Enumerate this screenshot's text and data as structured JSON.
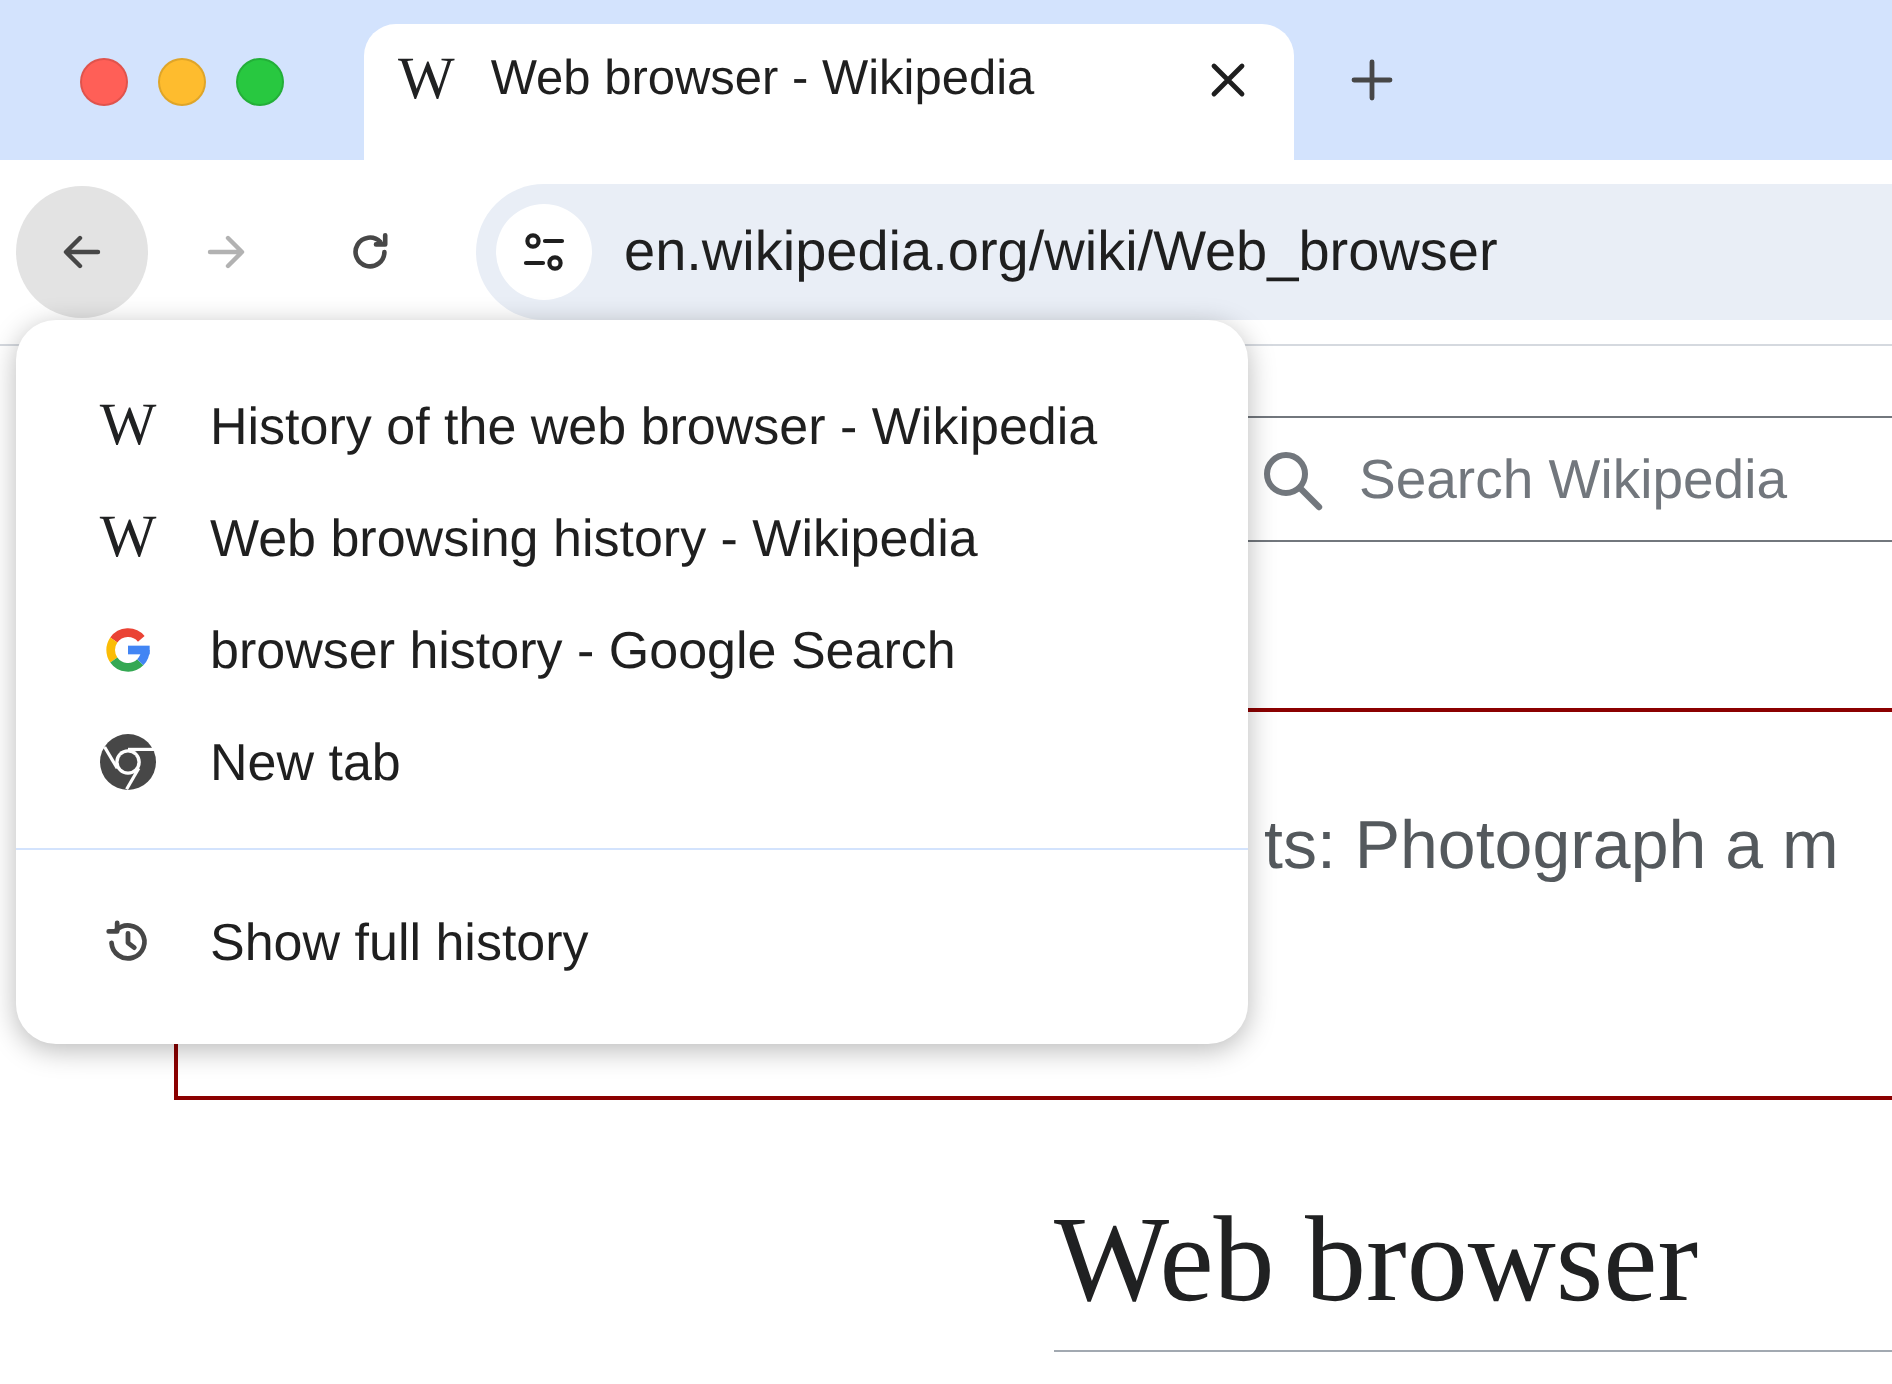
{
  "tabs": [
    {
      "title": "Web browser - Wikipedia",
      "favicon": "W",
      "selected": true
    }
  ],
  "toolbar": {
    "buttons": [
      {
        "kind": "back",
        "pressed": true,
        "disabled": false
      },
      {
        "kind": "forward",
        "pressed": false,
        "disabled": true
      },
      {
        "kind": "reload",
        "pressed": false,
        "disabled": false
      }
    ],
    "url": "en.wikipedia.org/wiki/Web_browser"
  },
  "page": {
    "search": {
      "placeholder": "Search Wikipedia"
    },
    "banner": {
      "text": "ts: Photograph a m"
    },
    "heading": "Web browser"
  },
  "back_menu": {
    "entries": [
      {
        "kind": "letter",
        "favicon": "W",
        "label": "History of the web browser - Wikipedia"
      },
      {
        "kind": "letter",
        "favicon": "W",
        "label": "Web browsing history - Wikipedia"
      },
      {
        "kind": "google",
        "label": "browser history - Google Search"
      },
      {
        "kind": "chrome",
        "label": "New tab"
      }
    ],
    "footer": {
      "label": "Show full history"
    }
  }
}
